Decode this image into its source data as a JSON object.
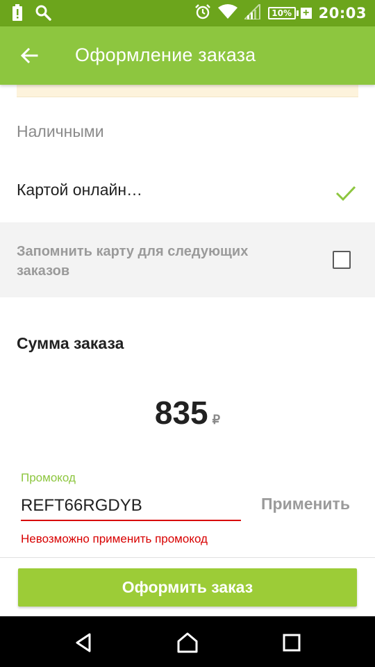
{
  "status_bar": {
    "time": "20:03",
    "battery": "10%",
    "icons": [
      "warning-icon",
      "search-icon",
      "alarm-icon",
      "wifi-icon",
      "signal-icon",
      "battery-icon"
    ]
  },
  "app_bar": {
    "title": "Оформление заказа",
    "back_icon": "arrow-back-icon"
  },
  "payment": {
    "cash_label": "Наличными",
    "card_label": "Картой онлайн…",
    "card_selected": true,
    "remember_label": "Запомнить карту для следующих заказов",
    "remember_checked": false
  },
  "summary": {
    "title": "Сумма заказа",
    "amount": "835",
    "currency": "₽"
  },
  "promo": {
    "label": "Промокод",
    "value": "REFT66RGDYB",
    "apply_label": "Применить",
    "error": "Невозможно применить промокод"
  },
  "actions": {
    "order_label": "Оформить заказ"
  },
  "colors": {
    "status_bar": "#6ca51c",
    "app_bar": "#8dc63f",
    "accent": "#8dc63f",
    "order_button": "#9ccc37",
    "error": "#d80000"
  }
}
